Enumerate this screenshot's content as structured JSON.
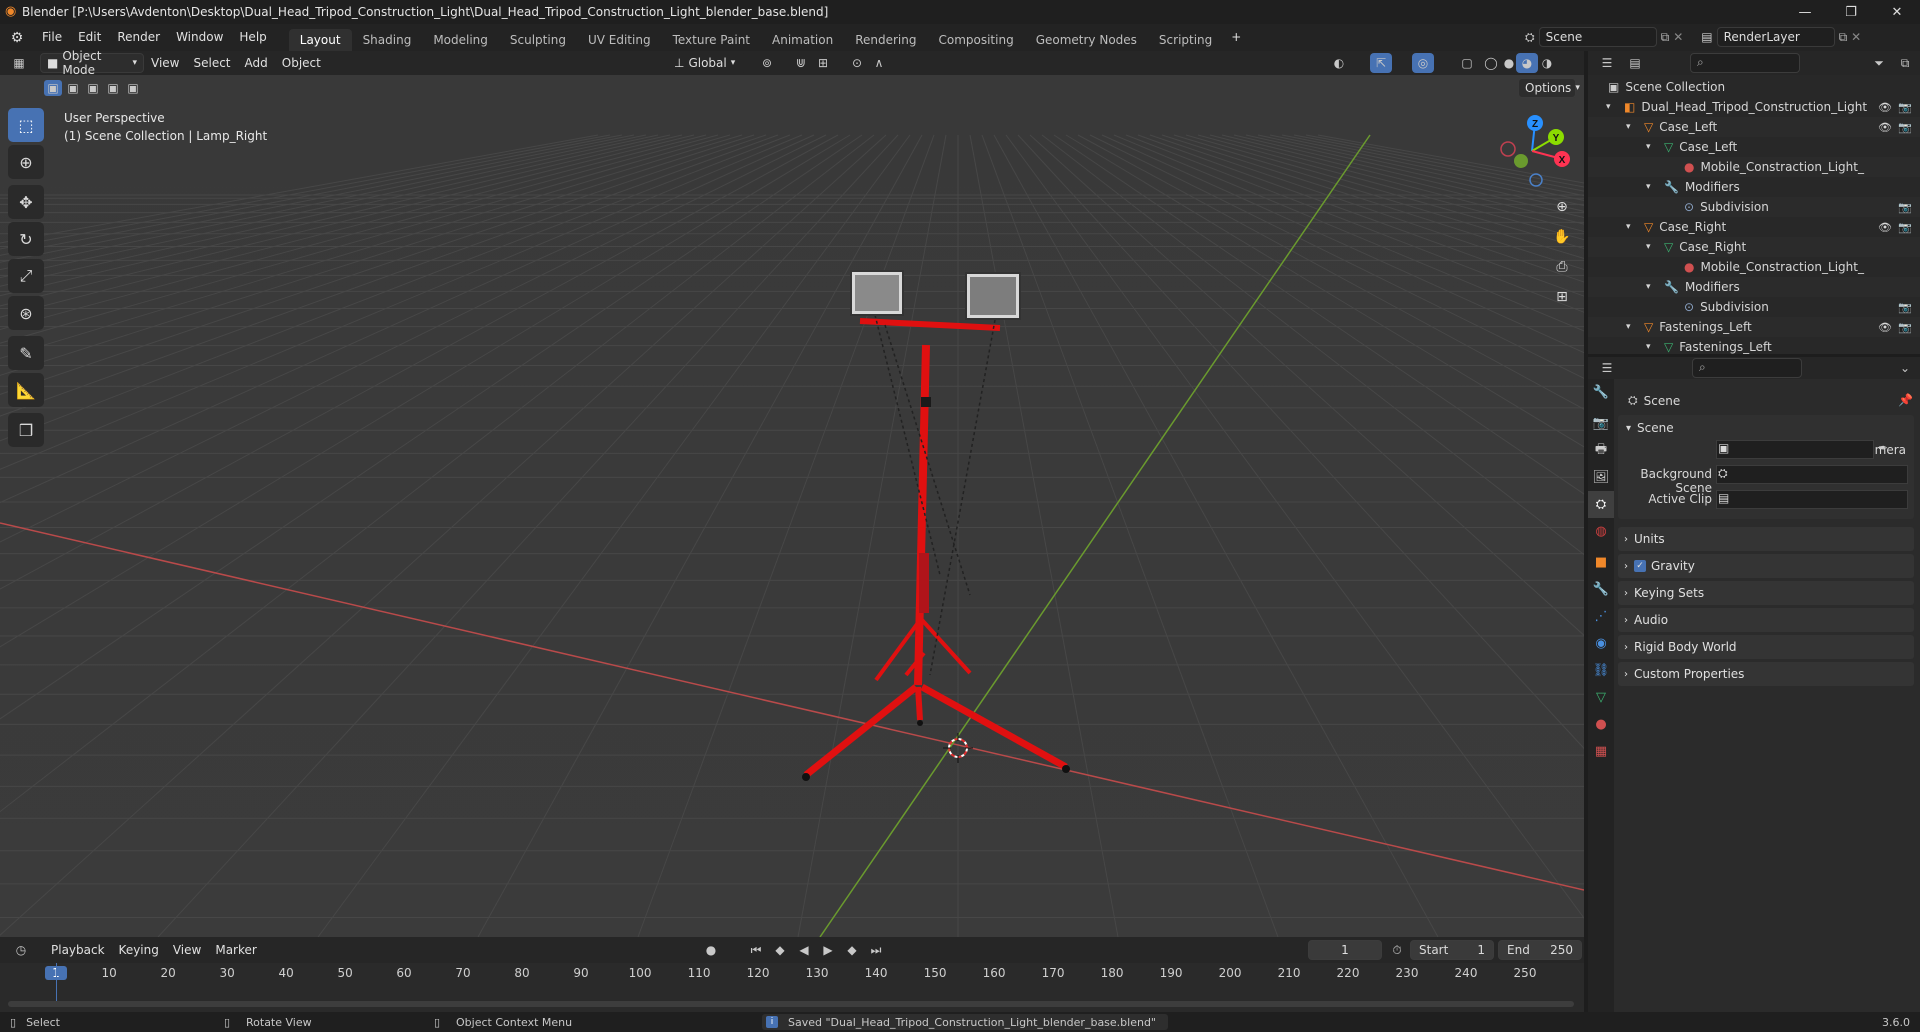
{
  "title": "Blender [P:\\Users\\Avdenton\\Desktop\\Dual_Head_Tripod_Construction_Light\\Dual_Head_Tripod_Construction_Light_blender_base.blend]",
  "menu": [
    "File",
    "Edit",
    "Render",
    "Window",
    "Help"
  ],
  "workspaces": [
    "Layout",
    "Shading",
    "Modeling",
    "Sculpting",
    "UV Editing",
    "Texture Paint",
    "Animation",
    "Rendering",
    "Compositing",
    "Geometry Nodes",
    "Scripting"
  ],
  "active_workspace": "Layout",
  "scene_name": "Scene",
  "view_layer": "RenderLayer",
  "viewport": {
    "mode": "Object Mode",
    "menus": [
      "View",
      "Select",
      "Add",
      "Object"
    ],
    "transform_orientation": "Global",
    "options_label": "Options",
    "perspective": "User Perspective",
    "collection_info": "(1) Scene Collection | Lamp_Right"
  },
  "gizmo": {
    "x": "X",
    "y": "Y",
    "z": "Z"
  },
  "outliner": {
    "root": "Scene Collection",
    "rows": [
      {
        "label": "Dual_Head_Tripod_Construction_Light",
        "indent": 0,
        "icon": "collection",
        "eye": true
      },
      {
        "label": "Case_Left",
        "indent": 1,
        "icon": "object",
        "eye": true
      },
      {
        "label": "Case_Left",
        "indent": 2,
        "icon": "mesh",
        "eye": false
      },
      {
        "label": "Mobile_Constraction_Light_",
        "indent": 3,
        "icon": "material",
        "eye": false
      },
      {
        "label": "Modifiers",
        "indent": 2,
        "icon": "wrench",
        "eye": false
      },
      {
        "label": "Subdivision",
        "indent": 3,
        "icon": "modifier",
        "eye": false
      },
      {
        "label": "Case_Right",
        "indent": 1,
        "icon": "object",
        "eye": true
      },
      {
        "label": "Case_Right",
        "indent": 2,
        "icon": "mesh",
        "eye": false
      },
      {
        "label": "Mobile_Constraction_Light_",
        "indent": 3,
        "icon": "material",
        "eye": false
      },
      {
        "label": "Modifiers",
        "indent": 2,
        "icon": "wrench",
        "eye": false
      },
      {
        "label": "Subdivision",
        "indent": 3,
        "icon": "modifier",
        "eye": false
      },
      {
        "label": "Fastenings_Left",
        "indent": 1,
        "icon": "object",
        "eye": true
      },
      {
        "label": "Fastenings_Left",
        "indent": 2,
        "icon": "mesh",
        "eye": false
      }
    ]
  },
  "properties": {
    "header": "Scene",
    "section": "Scene",
    "camera_label": "Camera",
    "bg_scene_label": "Background Scene",
    "active_clip_label": "Active Clip",
    "panels": [
      "Units",
      "Gravity",
      "Keying Sets",
      "Audio",
      "Rigid Body World",
      "Custom Properties"
    ],
    "gravity_checked": true
  },
  "timeline": {
    "menus": [
      "Playback",
      "Keying",
      "View",
      "Marker"
    ],
    "current_frame": "1",
    "start_label": "Start",
    "start": "1",
    "end_label": "End",
    "end": "250",
    "ticks": [
      "1",
      "10",
      "20",
      "30",
      "40",
      "50",
      "60",
      "70",
      "80",
      "90",
      "100",
      "110",
      "120",
      "130",
      "140",
      "150",
      "160",
      "170",
      "180",
      "190",
      "200",
      "210",
      "220",
      "230",
      "240",
      "250"
    ]
  },
  "status": {
    "select": "Select",
    "rotate": "Rotate View",
    "context": "Object Context Menu",
    "message": "Saved \"Dual_Head_Tripod_Construction_Light_blender_base.blend\"",
    "version": "3.6.0"
  },
  "colors": {
    "accent": "#4772b3",
    "x_axis": "#ff3352",
    "y_axis": "#8bdc00",
    "z_axis": "#2890ff",
    "tripod": "#e01010"
  }
}
